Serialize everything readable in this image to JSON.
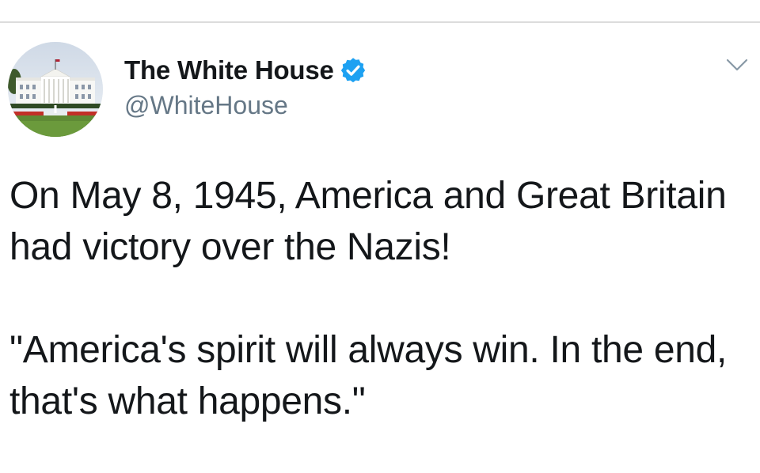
{
  "tweet": {
    "author": {
      "display_name": "The White House",
      "handle": "@WhiteHouse",
      "verified": true,
      "avatar_icon": "white-house-photo"
    },
    "menu_icon": "chevron-down-icon",
    "body": {
      "paragraph_1": "On May 8, 1945, America and Great Britain had victory over the Nazis!",
      "paragraph_2": "\"America's spirit will always win. In the end, that's what happens.\""
    }
  },
  "colors": {
    "verified_badge": "#1da1f2",
    "handle_text": "#657786",
    "body_text": "#14171a"
  }
}
